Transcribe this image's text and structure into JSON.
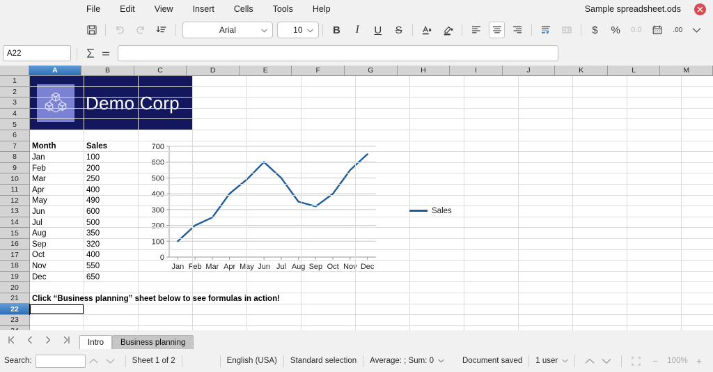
{
  "window": {
    "document_title": "Sample spreadsheet.ods",
    "close_icon": "close-icon"
  },
  "menu": {
    "items": [
      "File",
      "Edit",
      "View",
      "Insert",
      "Cells",
      "Tools",
      "Help"
    ]
  },
  "toolbar": {
    "save_icon": "save-icon",
    "undo_icon": "undo-icon",
    "redo_icon": "redo-icon",
    "sort_icon": "sort-descending-icon",
    "font_name": "Arial",
    "font_size": "10",
    "bold_label": "B",
    "italic_label": "I",
    "underline_label": "U",
    "strikethrough_label": "S",
    "font_color_icon": "font-color-icon",
    "highlight_icon": "highlight-color-icon",
    "align_left_icon": "align-left-icon",
    "align_center_icon": "align-center-icon",
    "align_right_icon": "align-right-icon",
    "wrap_text_icon": "wrap-text-icon",
    "merge_cells_icon": "merge-cells-icon",
    "currency_label": "$",
    "percent_label": "%",
    "number_format_label": "0.0",
    "date_icon": "date-format-icon",
    "add_decimal_label": ".00",
    "overflow_icon": "chevron-down-icon"
  },
  "formula_bar": {
    "name_box_value": "A22",
    "sum_icon": "sum-sigma-icon",
    "equals_icon": "equals-icon",
    "input_value": ""
  },
  "grid": {
    "columns": [
      "A",
      "B",
      "C",
      "D",
      "E",
      "F",
      "G",
      "H",
      "I",
      "J",
      "K",
      "L",
      "M"
    ],
    "selected_column": "A",
    "rows": [
      "1",
      "2",
      "3",
      "4",
      "5",
      "6",
      "7",
      "8",
      "9",
      "10",
      "11",
      "12",
      "13",
      "14",
      "15",
      "16",
      "17",
      "18",
      "19",
      "20",
      "21",
      "22",
      "23",
      "24"
    ],
    "selected_row": "22",
    "active_cell": "A22",
    "logo": {
      "company_name": "Demo Corp",
      "mark_icon": "cubes-logo-icon",
      "banner_color": "#13175e",
      "mark_color": "#7b82d4"
    },
    "table": {
      "headers": [
        "Month",
        "Sales"
      ],
      "rows": [
        [
          "Jan",
          "100"
        ],
        [
          "Feb",
          "200"
        ],
        [
          "Mar",
          "250"
        ],
        [
          "Apr",
          "400"
        ],
        [
          "May",
          "490"
        ],
        [
          "Jun",
          "600"
        ],
        [
          "Jul",
          "500"
        ],
        [
          "Aug",
          "350"
        ],
        [
          "Sep",
          "320"
        ],
        [
          "Oct",
          "400"
        ],
        [
          "Nov",
          "550"
        ],
        [
          "Dec",
          "650"
        ]
      ]
    },
    "note": "Click “Business planning” sheet below to see formulas in action!"
  },
  "chart_data": {
    "type": "line",
    "title": "",
    "xlabel": "",
    "ylabel": "",
    "categories": [
      "Jan",
      "Feb",
      "Mar",
      "Apr",
      "May",
      "Jun",
      "Jul",
      "Aug",
      "Sep",
      "Oct",
      "Nov",
      "Dec"
    ],
    "series": [
      {
        "name": "Sales",
        "values": [
          100,
          200,
          250,
          400,
          490,
          600,
          500,
          350,
          320,
          400,
          550,
          650
        ],
        "color": "#1f5c99"
      }
    ],
    "ylim": [
      0,
      700
    ],
    "yticks": [
      0,
      100,
      200,
      300,
      400,
      500,
      600,
      700
    ],
    "grid": true,
    "legend_position": "right",
    "legend_entries": [
      "Sales"
    ]
  },
  "sheet_tabs": {
    "first_icon": "first-sheet-icon",
    "prev_icon": "previous-sheet-icon",
    "next_icon": "next-sheet-icon",
    "last_icon": "last-sheet-icon",
    "tabs": [
      {
        "label": "Intro",
        "active": true
      },
      {
        "label": "Business planning",
        "active": false
      }
    ]
  },
  "status_bar": {
    "search_label": "Search:",
    "search_value": "",
    "find_prev_icon": "find-previous-icon",
    "find_next_icon": "find-next-icon",
    "sheet_count": "Sheet 1 of 2",
    "language": "English (USA)",
    "selection_mode": "Standard selection",
    "formula_summary": "Average: ; Sum: 0",
    "save_status": "Document saved",
    "users": "1 user",
    "zoom_out_label": "−",
    "zoom_level": "100%",
    "zoom_in_label": "+",
    "fit_icon": "fit-selection-icon"
  }
}
